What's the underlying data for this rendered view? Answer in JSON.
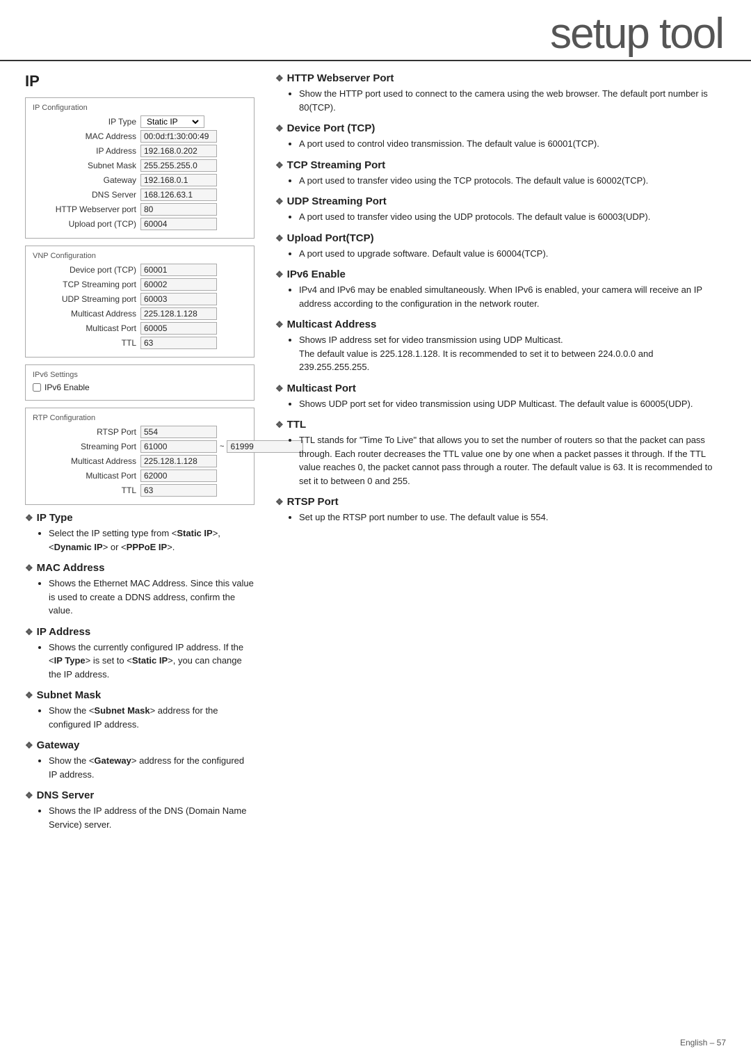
{
  "header": {
    "title": "setup tool"
  },
  "page_footer": "English – 57",
  "left": {
    "section_title": "IP",
    "ip_config": {
      "box_title": "IP Configuration",
      "rows": [
        {
          "label": "IP Type",
          "value": "Static IP",
          "type": "select"
        },
        {
          "label": "MAC Address",
          "value": "00:0d:f1:30:00:49",
          "type": "text"
        },
        {
          "label": "IP Address",
          "value": "192.168.0.202",
          "type": "text"
        },
        {
          "label": "Subnet Mask",
          "value": "255.255.255.0",
          "type": "text"
        },
        {
          "label": "Gateway",
          "value": "192.168.0.1",
          "type": "text"
        },
        {
          "label": "DNS Server",
          "value": "168.126.63.1",
          "type": "text"
        },
        {
          "label": "HTTP Webserver port",
          "value": "80",
          "type": "text"
        },
        {
          "label": "Upload port (TCP)",
          "value": "60004",
          "type": "text"
        }
      ]
    },
    "vnp_config": {
      "box_title": "VNP Configuration",
      "rows": [
        {
          "label": "Device port (TCP)",
          "value": "60001",
          "type": "text"
        },
        {
          "label": "TCP Streaming port",
          "value": "60002",
          "type": "text"
        },
        {
          "label": "UDP Streaming port",
          "value": "60003",
          "type": "text"
        },
        {
          "label": "Multicast Address",
          "value": "225.128.1.128",
          "type": "text"
        },
        {
          "label": "Multicast Port",
          "value": "60005",
          "type": "text"
        },
        {
          "label": "TTL",
          "value": "63",
          "type": "text"
        }
      ]
    },
    "ipv6_config": {
      "box_title": "IPv6 Settings",
      "checkbox_label": "IPv6 Enable"
    },
    "rtp_config": {
      "box_title": "RTP Configuration",
      "rows": [
        {
          "label": "RTSP Port",
          "value": "554",
          "type": "text"
        },
        {
          "label": "Streaming Port",
          "value": "61000",
          "value2": "61999",
          "type": "range"
        },
        {
          "label": "Multicast Address",
          "value": "225.128.1.128",
          "type": "text"
        },
        {
          "label": "Multicast Port",
          "value": "62000",
          "type": "text"
        },
        {
          "label": "TTL",
          "value": "63",
          "type": "text"
        }
      ]
    },
    "help_items": [
      {
        "id": "ip-type",
        "heading": "IP Type",
        "bullets": [
          "Select the IP setting type from <Static IP>, <Dynamic IP> or <PPPoE IP>."
        ]
      },
      {
        "id": "mac-address",
        "heading": "MAC Address",
        "bullets": [
          "Shows the Ethernet MAC Address. Since this value is used to create a DDNS address, confirm the value."
        ]
      },
      {
        "id": "ip-address",
        "heading": "IP Address",
        "bullets": [
          "Shows the currently configured IP address. If the <IP Type> is set to <Static IP>, you can change the IP address."
        ]
      },
      {
        "id": "subnet-mask",
        "heading": "Subnet Mask",
        "bullets": [
          "Show the <Subnet Mask> address for the configured IP address."
        ]
      },
      {
        "id": "gateway",
        "heading": "Gateway",
        "bullets": [
          "Show the <Gateway> address for the configured IP address."
        ]
      },
      {
        "id": "dns-server",
        "heading": "DNS Server",
        "bullets": [
          "Shows the IP address of the DNS (Domain Name Service) server."
        ]
      }
    ]
  },
  "right": {
    "help_items": [
      {
        "id": "http-webserver-port",
        "heading": "HTTP Webserver Port",
        "bullets": [
          "Show the HTTP port used to connect to the camera using the web browser. The default port number is 80(TCP)."
        ]
      },
      {
        "id": "device-port-tcp",
        "heading": "Device Port (TCP)",
        "bullets": [
          "A port used to control video transmission. The default value is 60001(TCP)."
        ]
      },
      {
        "id": "tcp-streaming-port",
        "heading": "TCP Streaming Port",
        "bullets": [
          "A port used to transfer video using the TCP protocols. The default value is 60002(TCP)."
        ]
      },
      {
        "id": "udp-streaming-port",
        "heading": "UDP Streaming Port",
        "bullets": [
          "A port used to transfer video using the UDP protocols. The default value is 60003(UDP)."
        ]
      },
      {
        "id": "upload-port-tcp",
        "heading": "Upload Port(TCP)",
        "bullets": [
          "A port used to upgrade software. Default value is 60004(TCP)."
        ]
      },
      {
        "id": "ipv6-enable",
        "heading": "IPv6 Enable",
        "bullets": [
          "IPv4 and IPv6 may be enabled simultaneously. When IPv6 is enabled, your camera will receive an IP address according to the configuration in the network router."
        ]
      },
      {
        "id": "multicast-address",
        "heading": "Multicast Address",
        "bullets": [
          "Shows IP address set for video transmission using UDP Multicast.\nThe default value is 225.128.1.128. It is recommended to set it to between 224.0.0.0 and 239.255.255.255."
        ]
      },
      {
        "id": "multicast-port",
        "heading": "Multicast Port",
        "bullets": [
          "Shows UDP port set for video transmission using UDP Multicast. The default value is 60005(UDP)."
        ]
      },
      {
        "id": "ttl",
        "heading": "TTL",
        "bullets": [
          "TTL stands for \"Time To Live\" that allows you to set the number of routers so that the packet can pass through. Each router decreases the TTL value one by one when a packet passes it through. If the TTL value reaches 0, the packet cannot pass through a router. The default value is 63. It is recommended to set it to between 0 and 255."
        ]
      },
      {
        "id": "rtsp-port",
        "heading": "RTSP Port",
        "bullets": [
          "Set up the RTSP port number to use. The default value is 554."
        ]
      }
    ]
  }
}
